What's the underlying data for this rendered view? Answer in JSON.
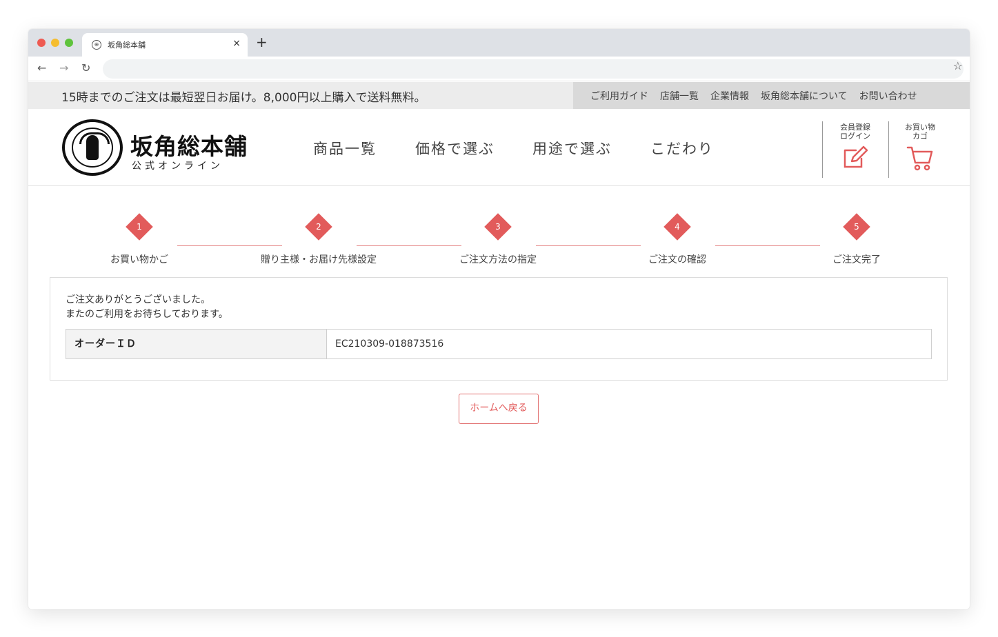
{
  "browser": {
    "tab_title": "坂角総本舗",
    "new_tab_label": "+",
    "close_label": "×",
    "back_label": "←",
    "forward_label": "→",
    "reload_label": "↻",
    "bookmark_label": "☆",
    "address": ""
  },
  "notice": {
    "text": "15時までのご注文は最短翌日お届け。8,000円以上購入で送料無料。"
  },
  "utility_nav": [
    {
      "label": "ご利用ガイド"
    },
    {
      "label": "店舗一覧"
    },
    {
      "label": "企業情報"
    },
    {
      "label": "坂角総本舗について"
    },
    {
      "label": "お問い合わせ"
    }
  ],
  "logo": {
    "name": "坂角総本舗",
    "sub": "公式オンライン"
  },
  "main_nav": [
    {
      "label": "商品一覧"
    },
    {
      "label": "価格で選ぶ"
    },
    {
      "label": "用途で選ぶ"
    },
    {
      "label": "こだわり"
    }
  ],
  "header_buttons": {
    "member": "会員登録\nログイン",
    "cart": "お買い物\nカゴ"
  },
  "colors": {
    "accent": "#e25b5b"
  },
  "steps": [
    {
      "num": "1",
      "label": "お買い物かご"
    },
    {
      "num": "2",
      "label": "贈り主様・お届け先様設定"
    },
    {
      "num": "3",
      "label": "ご注文方法の指定"
    },
    {
      "num": "4",
      "label": "ご注文の確認"
    },
    {
      "num": "5",
      "label": "ご注文完了"
    }
  ],
  "complete": {
    "line1": "ご注文ありがとうございました。",
    "line2": "またのご利用をお待ちしております。",
    "order_label": "オーダーＩＤ",
    "order_id": "EC210309-018873516"
  },
  "home_button": "ホームへ戻る"
}
